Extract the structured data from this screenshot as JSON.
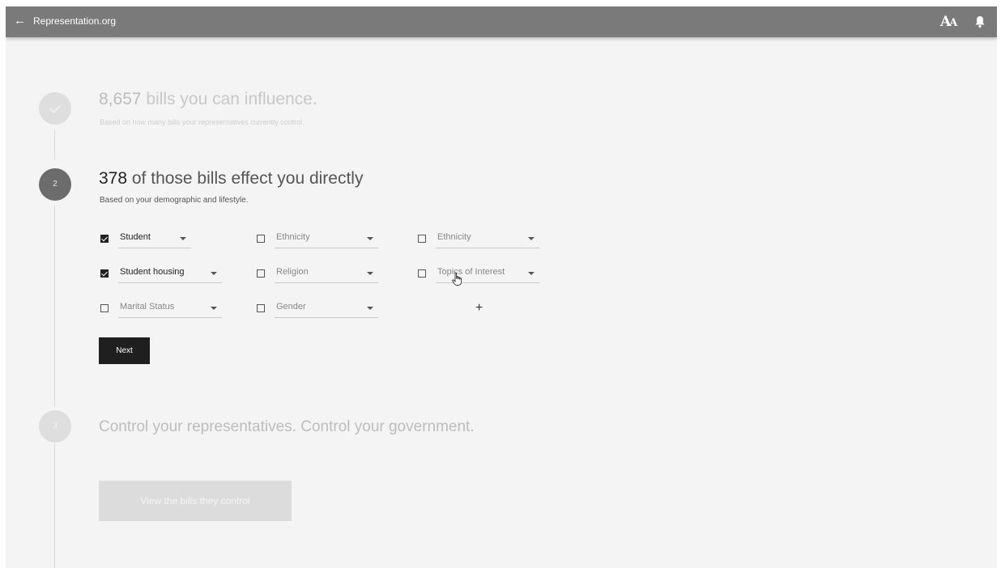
{
  "topbar": {
    "back_icon": "arrow-left-icon",
    "title": "Representation.org",
    "font_size_icon": "text-size-icon",
    "notification_icon": "bell-icon"
  },
  "steps": [
    {
      "indicator": "check-icon",
      "count": "8,657",
      "headline_rest": " bills you can influence.",
      "subline": "Based on how many bills your representatives currently control."
    },
    {
      "indicator": "2",
      "count": "378",
      "headline_rest": " of those bills effect you directly",
      "subline": "Based on your demographic and lifestyle.",
      "filters": [
        {
          "label": "Student",
          "checked": true
        },
        {
          "label": "Ethnicity",
          "checked": false
        },
        {
          "label": "Ethnicity",
          "checked": false
        },
        {
          "label": "Student housing",
          "checked": true
        },
        {
          "label": "Religion",
          "checked": false
        },
        {
          "label": "Topics of Interest",
          "checked": false
        },
        {
          "label": "Marital Status",
          "checked": false
        },
        {
          "label": "Gender",
          "checked": false
        }
      ],
      "add_label": "+",
      "next_label": "Next"
    },
    {
      "indicator": "3",
      "headline": "Control your representatives. Control your government.",
      "button_label": "View the bills they control"
    }
  ],
  "colors": {
    "topbar": "#7a7a7a",
    "background": "#f4f4f4",
    "primary_button": "#1f1f1f",
    "active_step": "#6c6c6c",
    "inactive_step": "#dedede"
  }
}
